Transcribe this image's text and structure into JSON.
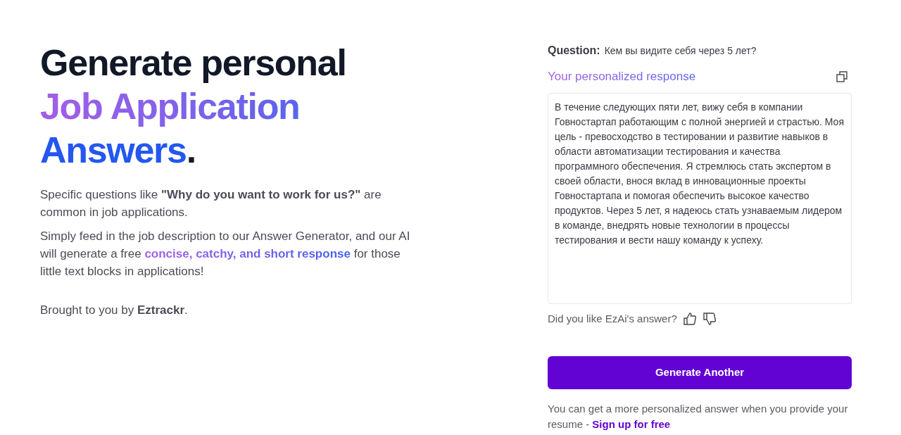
{
  "hero": {
    "title_line_1": "Generate personal",
    "title_line_2": "Job Application",
    "title_line_3": "Answers",
    "title_period": ".",
    "paragraph_1": "Specific questions like **\"Why do you want to work for us?\"** are common in job applications.",
    "paragraph_2": {
      "before": "Simply feed in the job description to our Answer Generator, and our AI will generate a free ",
      "highlight": "concise, catchy, and short response",
      "after": " for those little text blocks in applications!"
    },
    "credit": "Brought to you by **Eztrackr**."
  },
  "result": {
    "question_label": "Question:",
    "question": "Кем вы видите себя через 5 лет?",
    "response_title": "Your personalized response",
    "response": "В течение следующих пяти лет, вижу себя в компании Говностартап работающим с полной энергией и страстью. Моя цель - превосходство в тестировании и развитие навыков в области автоматизации тестирования и качества программного обеспечения. Я стремлюсь стать экспертом в своей области, внося вклад в инновационные проекты Говностартапа и помогая обеспечить высокое качество продуктов. Через 5 лет, я надеюсь стать узнаваемым лидером в команде, внедрять новые технологии в процессы тестирования и вести нашу команду к успеху.",
    "feedback_prompt": "Did you like EzAi's answer?",
    "button": "Generate Another",
    "footer_text": "You can get a more personalized answer when you provide your resume - ",
    "footer_link": "Sign up for free"
  }
}
